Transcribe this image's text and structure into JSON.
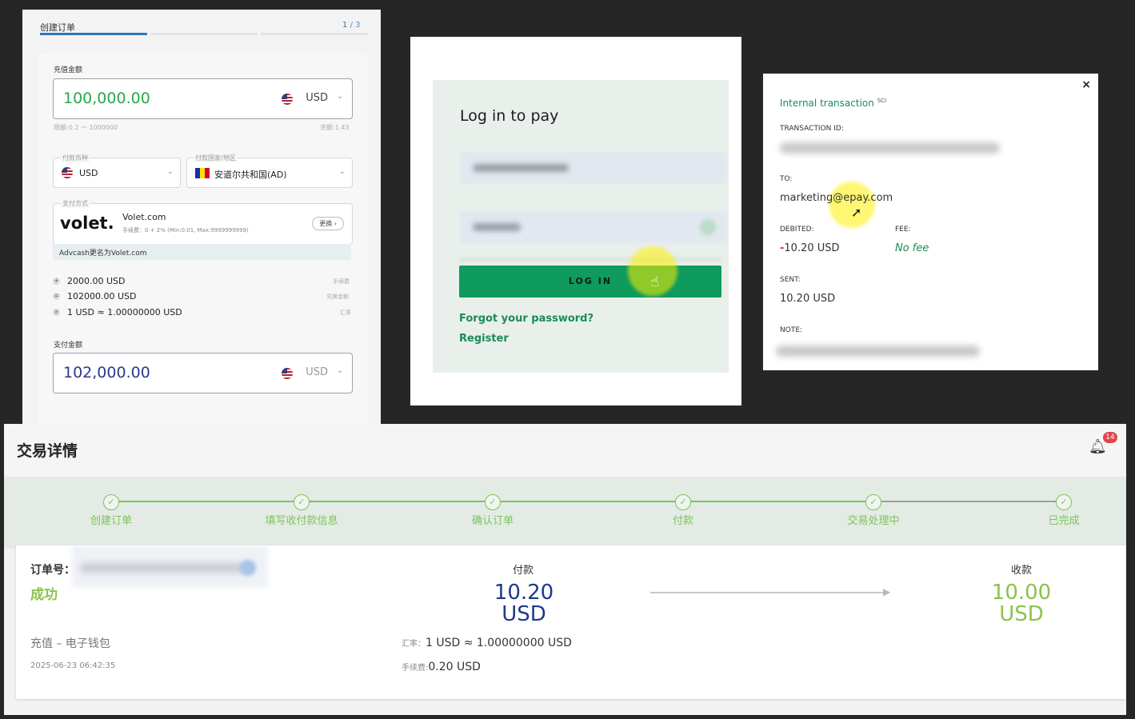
{
  "create_order": {
    "title": "创建订单",
    "step_current": "1",
    "step_total": "/ 3",
    "recharge_label": "充值金额",
    "recharge_amount": "100,000.00",
    "recharge_currency": "USD",
    "limit_text": "限额:0.2 ～ 1000000",
    "balance_text": "余额:1.43",
    "pay_currency_label": "付款币种",
    "pay_currency": "USD",
    "pay_country_label": "付款国家/地区",
    "pay_country": "安道尔共和国(AD)",
    "pay_method_label": "支付方式",
    "volet_logo": "volet.",
    "method_name": "Volet.com",
    "method_fee": "手续费：0 + 2% (Min:0.01, Max:9999999999)",
    "change_button": "更换 ›",
    "rename_notice": "Advcash更名为Volet.com",
    "fee_row": "2000.00 USD",
    "fee_tag": "手续费",
    "exchange_row": "102000.00 USD",
    "exchange_tag": "兑换金额",
    "rate_row": "1 USD ≈ 1.00000000 USD",
    "rate_tag": "汇率",
    "pay_amount_label": "支付金额",
    "pay_amount": "102,000.00",
    "pay_amount_currency": "USD",
    "colors": {
      "green_amount": "#2aa84a",
      "blue_amount": "#2b3a8c"
    }
  },
  "login": {
    "heading": "Log in to pay",
    "button": "LOG IN",
    "forgot": "Forgot your password?",
    "register": "Register",
    "accent": "#0f9a5e"
  },
  "transaction": {
    "title": "Internal transaction",
    "title_sup": "SCI",
    "close": "×",
    "id_label": "TRANSACTION ID:",
    "to_label": "TO:",
    "to_value": "marketing@epay.com",
    "debited_label": "DEBITED:",
    "debited_sign": "-",
    "debited_value": "10.20 USD",
    "fee_label": "FEE:",
    "fee_value": "No fee",
    "sent_label": "SENT:",
    "sent_value": "10.20 USD",
    "note_label": "NOTE:"
  },
  "detail": {
    "title": "交易详情",
    "notification_count": "14",
    "steps": [
      "创建订单",
      "填写收付款信息",
      "确认订单",
      "付款",
      "交易处理中",
      "已完成"
    ],
    "order_label": "订单号：",
    "status": "成功",
    "type": "充值 – 电子钱包",
    "datetime": "2025-06-23 06:42:35",
    "pay_label": "付款",
    "pay_amount": "10.20",
    "pay_currency": "USD",
    "rate_label": "汇率：",
    "rate_value": "1 USD ≈ 1.00000000 USD",
    "fee_label": "手续费:",
    "fee_value": "0.20 USD",
    "receive_label": "收款",
    "receive_amount": "10.00",
    "receive_currency": "USD"
  }
}
